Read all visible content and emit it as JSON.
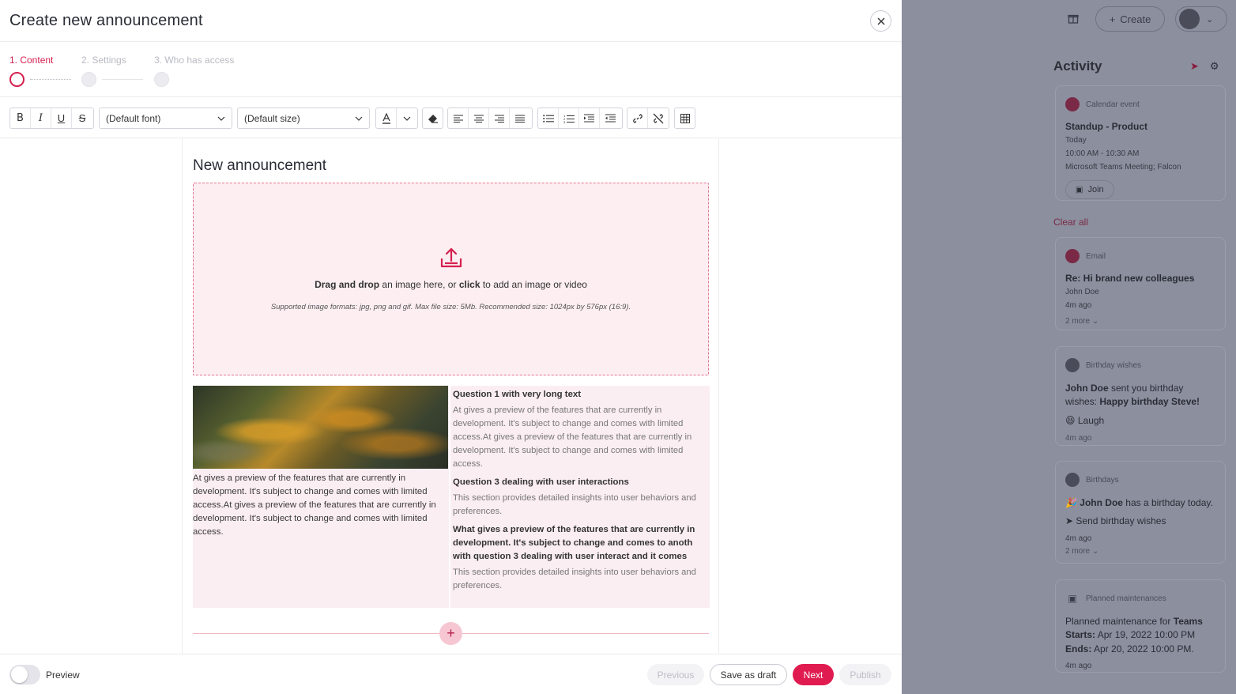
{
  "dialog": {
    "title": "Create new announcement",
    "close_icon": "close-icon"
  },
  "steps": [
    {
      "label": "1. Content",
      "active": true
    },
    {
      "label": "2. Settings",
      "active": false
    },
    {
      "label": "3. Who has access",
      "active": false
    }
  ],
  "toolbar": {
    "bold": "B",
    "italic": "I",
    "underline": "U",
    "strike": "S",
    "font_select": "(Default font)",
    "size_select": "(Default size)"
  },
  "editor": {
    "title": "New announcement",
    "dropzone": {
      "drag_bold": "Drag and drop",
      "text_mid": " an image here, or ",
      "click_bold": "click",
      "text_end": " to add an image or video",
      "sub": "Supported image formats: jpg, png and gif. Max file size: 5Mb. Recommended size: 1024px by 576px (16:9)."
    },
    "left_text": "At gives a preview of the features that are currently in development. It's subject to change and comes with limited access.At gives a preview of the features that are currently in development. It's subject to change and comes with limited access.",
    "questions": [
      {
        "title": "Question 1 with very long text",
        "body": "At gives a preview of the features that are currently in development. It's subject to change and comes with limited access.At gives a preview of the features that are currently in development. It's subject to change and comes with limited access."
      },
      {
        "title": "Question 3 dealing with user interactions",
        "body": "This section provides detailed insights into user behaviors and preferences."
      },
      {
        "title": "What gives a preview of the features that are currently in development. It's subject to change and comes to anoth with question 3 dealing with user interact and it comes",
        "body": "This section provides detailed insights into user behaviors and preferences."
      }
    ]
  },
  "footer": {
    "preview_label": "Preview",
    "previous": "Previous",
    "save_draft": "Save as draft",
    "next": "Next",
    "publish": "Publish"
  },
  "backdrop": {
    "create_label": "Create",
    "activity_title": "Activity",
    "clear_all": "Clear all",
    "cards": {
      "calendar": {
        "type": "Calendar event",
        "title": "Standup - Product",
        "when": "Today",
        "time": "10:00 AM - 10:30 AM",
        "where": "Microsoft Teams Meeting; Falcon",
        "join": "Join"
      },
      "email": {
        "type": "Email",
        "title": "Re: Hi brand new colleagues",
        "from": "John Doe",
        "ago": "4m ago",
        "more": "2 more"
      },
      "birthday_wishes": {
        "type": "Birthday wishes",
        "name": "John Doe",
        "text1": " sent you birthday wishes: ",
        "wish": "Happy birthday Steve!",
        "reaction": "Laugh",
        "ago": "4m ago"
      },
      "birthdays": {
        "type": "Birthdays",
        "name": "John Doe",
        "text": " has a birthday today.",
        "send": "Send birthday wishes",
        "ago": "4m ago",
        "more": "2 more"
      },
      "maintenance": {
        "type": "Planned maintenances",
        "text": "Planned maintenance for ",
        "teams": "Teams",
        "starts_label": "Starts:",
        "starts": " Apr 19, 2022 10:00 PM",
        "ends_label": "Ends:",
        "ends": " Apr 20, 2022 10:00 PM.",
        "ago": "4m ago"
      }
    }
  },
  "colors": {
    "accent": "#e01b4f",
    "dropzone_bg": "#fdeef2",
    "backdrop": "#8c8f9e"
  }
}
